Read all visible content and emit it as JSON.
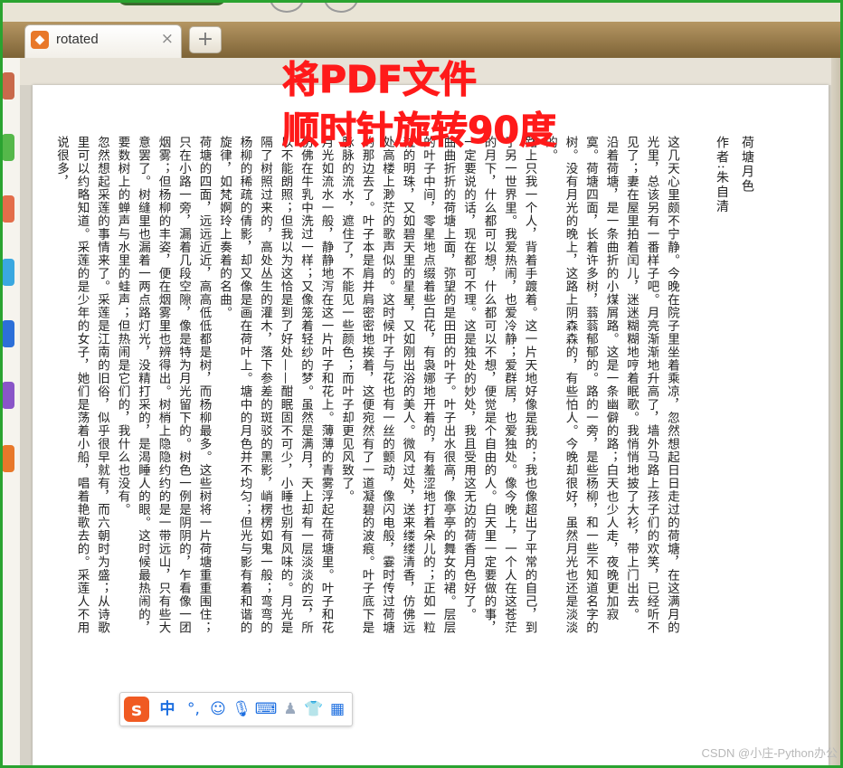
{
  "tab": {
    "label": "rotated",
    "close": "×"
  },
  "new_tab": "+",
  "headline": {
    "line1": "将PDF文件",
    "line2": "顺时针旋转90度"
  },
  "document": {
    "title": "荷塘月色",
    "author": "作者:朱自清",
    "paragraphs": [
      "这几天心里颇不宁静。今晚在院子里坐着乘凉，忽然想起日日走过的荷塘，在这满月的光里，总该另有一番样子吧。月亮渐渐地升高了，墙外马路上孩子们的欢笑，已经听不见了；妻在屋里拍着闰儿，迷迷糊糊地哼着眠歌。我悄悄地披了大衫，带上门出去。",
      "沿着荷塘，是一条曲折的小煤屑路。这是一条幽僻的路；白天也少人走，夜晚更加寂寞。荷塘四面，长着许多树，蓊蓊郁郁的。路的一旁，是些杨柳，和一些不知道名字的树。没有月光的晚上，这路上阴森森的，有些怕人。今晚却很好，虽然月光也还是淡淡的。",
      "路上只我一个人，背着手踱着。这一片天地好像是我的；我也像超出了平常的自己，到了另一世界里。我爱热闹，也爱冷静；爱群居，也爱独处。像今晚上，一个人在这苍茫的月下，什么都可以想，什么都可以不想，便觉是个自由的人。白天里一定要做的事，一定要说的话，现在都可不理。这是独处的妙处，我且受用这无边的荷香月色好了。",
      "曲曲折折的荷塘上面，弥望的是田田的叶子。叶子出水很高，像亭亭的舞女的裙。层层的叶子中间，零星地点缀着些白花，有袅娜地开着的，有羞涩地打着朵儿的；正如一粒粒的明珠，又如碧天里的星星，又如刚出浴的美人。微风过处，送来缕缕清香，仿佛远处高楼上渺茫的歌声似的。这时候叶子与花也有一丝的颤动，像闪电般，霎时传过荷塘的那边去了。叶子本是肩并肩密密地挨着，这便宛然有了一道凝碧的波痕。叶子底下是脉脉的流水，遮住了，不能见一些颜色；而叶子却更见风致了。",
      "月光如流水一般，静静地泻在这一片叶子和花上。薄薄的青雾浮起在荷塘里。叶子和花仿佛在牛乳中洗过一样；又像笼着轻纱的梦。虽然是满月，天上却有一层淡淡的云，所以不能朗照；但我以为这恰是到了好处——酣眠固不可少，小睡也别有风味的。月光是隔了树照过来的，高处丛生的灌木，落下参差的斑驳的黑影，峭楞楞如鬼一般；弯弯的杨柳的稀疏的倩影，却又像是画在荷叶上。塘中的月色并不均匀；但光与影有着和谐的旋律，如梵婀玲上奏着的名曲。",
      "荷塘的四面，远远近近，高高低低都是树，而杨柳最多。这些树将一片荷塘重重围住；只在小路一旁，漏着几段空隙，像是特为月光留下的。树色一例是阴阴的，乍看像一团烟雾；但杨柳的丰姿，便在烟雾里也辨得出。树梢上隐隐约约的是一带远山，只有些大意罢了。树缝里也漏着一两点路灯光，没精打采的，是渴睡人的眼。这时候最热闹的，要数树上的蝉声与水里的蛙声；但热闹是它们的，我什么也没有。",
      "忽然想起采莲的事情来了。采莲是江南的旧俗，似乎很早就有，而六朝时为盛；从诗歌里可以约略知道。采莲的是少年的女子，她们是荡着小船，唱着艳歌去的。采莲人不用说很多，"
    ]
  },
  "ime": {
    "logo": "s",
    "mode": "中",
    "punct": "°,",
    "icons": [
      "smile-icon",
      "mic-icon",
      "keyboard-icon",
      "user-icon",
      "shirt-icon",
      "grid-icon"
    ]
  },
  "watermark": "CSDN @小庄-Python办公",
  "colors": {
    "headline": "#ff1a1a",
    "frame": "#2aa330",
    "tab_icon": "#e8782a",
    "ime_blue": "#1c6ee0"
  }
}
